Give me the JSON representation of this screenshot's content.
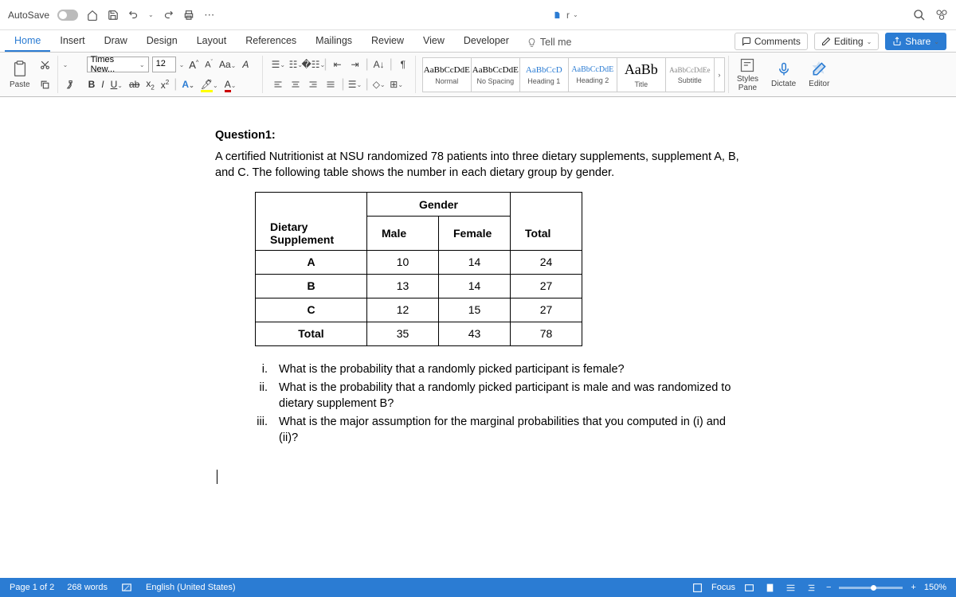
{
  "titlebar": {
    "autosave": "AutoSave",
    "doc_indicator": "r"
  },
  "tabs": [
    "Home",
    "Insert",
    "Draw",
    "Design",
    "Layout",
    "References",
    "Mailings",
    "Review",
    "View",
    "Developer"
  ],
  "tellme": "Tell me",
  "actions": {
    "comments": "Comments",
    "editing": "Editing",
    "share": "Share"
  },
  "ribbon": {
    "paste": "Paste",
    "font_name": "Times New...",
    "font_size": "12",
    "styles": [
      {
        "prev": "AaBbCcDdE",
        "label": "Normal"
      },
      {
        "prev": "AaBbCcDdE",
        "label": "No Spacing"
      },
      {
        "prev": "AaBbCcD",
        "label": "Heading 1"
      },
      {
        "prev": "AaBbCcDdE",
        "label": "Heading 2"
      },
      {
        "prev": "AaBb",
        "label": "Title"
      },
      {
        "prev": "AaBbCcDdEe",
        "label": "Subtitle"
      }
    ],
    "styles_pane": "Styles\nPane",
    "dictate": "Dictate",
    "editor": "Editor"
  },
  "chart_data": {
    "type": "table",
    "title": "Dietary supplement participants by gender",
    "columns": [
      "Dietary Supplement",
      "Male",
      "Female",
      "Total"
    ],
    "rows": [
      [
        "A",
        10,
        14,
        24
      ],
      [
        "B",
        13,
        14,
        27
      ],
      [
        "C",
        12,
        15,
        27
      ],
      [
        "Total",
        35,
        43,
        78
      ]
    ]
  },
  "doc": {
    "q_title": "Question1:",
    "q_para": "A certified Nutritionist at NSU randomized 78 patients into three dietary supplements, supplement A, B, and C. The following table shows the number in each dietary group by gender.",
    "th_gender": "Gender",
    "th_sup": "Dietary Supplement",
    "th_male": "Male",
    "th_female": "Female",
    "th_total": "Total",
    "r1": {
      "s": "A",
      "m": "10",
      "f": "14",
      "t": "24"
    },
    "r2": {
      "s": "B",
      "m": "13",
      "f": "14",
      "t": "27"
    },
    "r3": {
      "s": "C",
      "m": "12",
      "f": "15",
      "t": "27"
    },
    "r4": {
      "s": "Total",
      "m": "35",
      "f": "43",
      "t": "78"
    },
    "qi_n": "i.",
    "qi": "What is the probability that a randomly picked participant is female?",
    "qii_n": "ii.",
    "qii": "What is the probability that a randomly picked participant is male and was randomized to dietary supplement B?",
    "qiii_n": "iii.",
    "qiii": "What is the major assumption for the marginal probabilities that you computed in (i) and (ii)?"
  },
  "status": {
    "page": "Page 1 of 2",
    "words": "268 words",
    "lang": "English (United States)",
    "focus": "Focus",
    "zoom": "150%"
  }
}
